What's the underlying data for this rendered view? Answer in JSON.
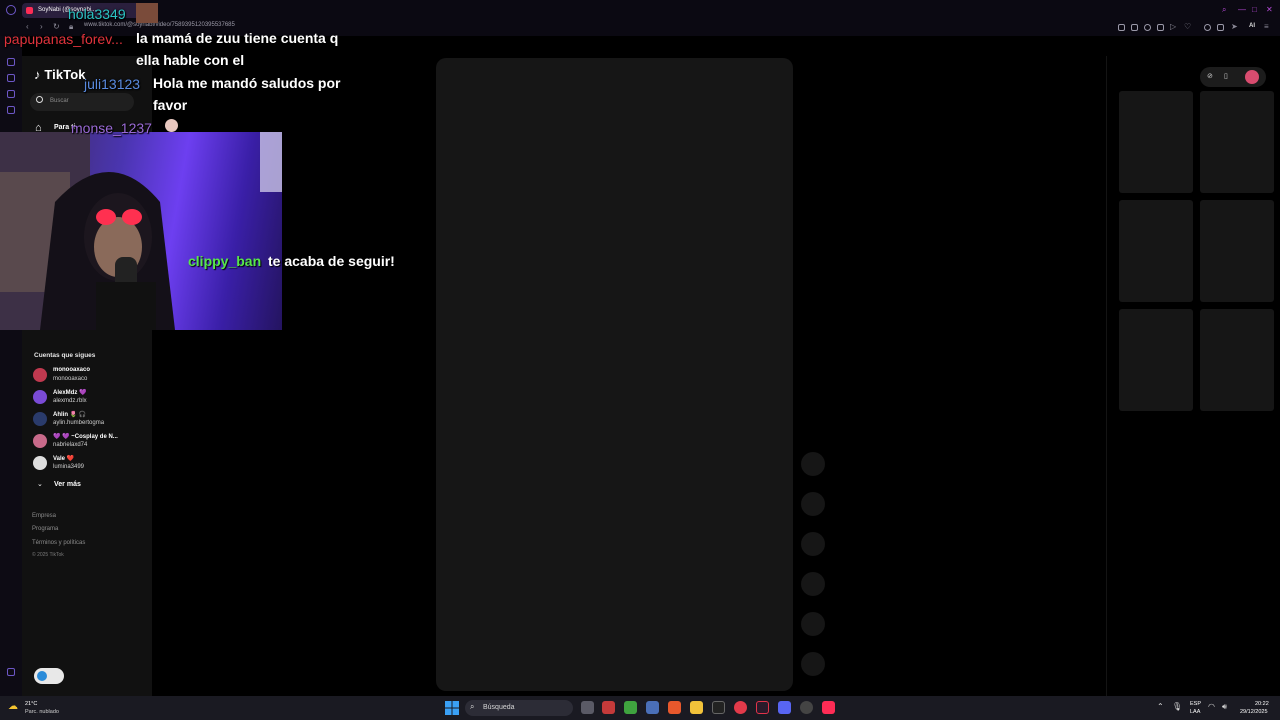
{
  "browser": {
    "tab_title": "SoyNabi (@soynabi...",
    "url": "www.tiktok.com/@soynabi/video/7589395120395537685",
    "ai_label": "AI",
    "win_controls": [
      "—",
      "□",
      "✕"
    ]
  },
  "tiktok": {
    "logo": "TikTok",
    "search_placeholder": "Buscar",
    "nav_for_you": "Para ti",
    "following_heading": "Cuentas que sigues",
    "accounts": [
      {
        "name": "monooaxaco",
        "handle": "monooaxaco",
        "color": "#c0394f"
      },
      {
        "name": "AlexMdz 💜",
        "handle": "alexmdz.rblx",
        "color": "#7a4bd6"
      },
      {
        "name": "Ahlin 🌷 🎧",
        "handle": "aylin.humbertogma",
        "color": "#2a3b6b"
      },
      {
        "name": "💜 💜 ~Cosplay de N...",
        "handle": "nabrielaxd74",
        "color": "#c86a8a"
      },
      {
        "name": "Vale ❤️",
        "handle": "lumina3499",
        "color": "#dedede"
      }
    ],
    "see_more": "Ver más",
    "footer_links": [
      "Empresa",
      "Programa",
      "Términos y políticas"
    ],
    "copyright": "© 2025 TikTok"
  },
  "stream_overlay": {
    "chat": [
      {
        "user": "hola3349",
        "user_color": "#2bc4c4",
        "message": ""
      },
      {
        "user": "papupanas_forev...",
        "user_color": "#e0333c",
        "message": "la mamá de zuu tiene cuenta q ella hable con el"
      },
      {
        "user": "juli13123",
        "user_color": "#5a8be0",
        "message": "Hola me mandó saludos por favor"
      },
      {
        "user": "monse_1237",
        "user_color": "#9b6bd6",
        "message": ""
      }
    ],
    "follow_alert": {
      "user": "clippy_ban",
      "message": "te acaba de seguir!"
    }
  },
  "taskbar": {
    "weather_temp": "21°C",
    "weather_condition": "Parc. nublado",
    "search_label": "Búsqueda",
    "lang_line1": "ESP",
    "lang_line2": "LAA",
    "time": "20:22",
    "date": "29/12/2025"
  }
}
